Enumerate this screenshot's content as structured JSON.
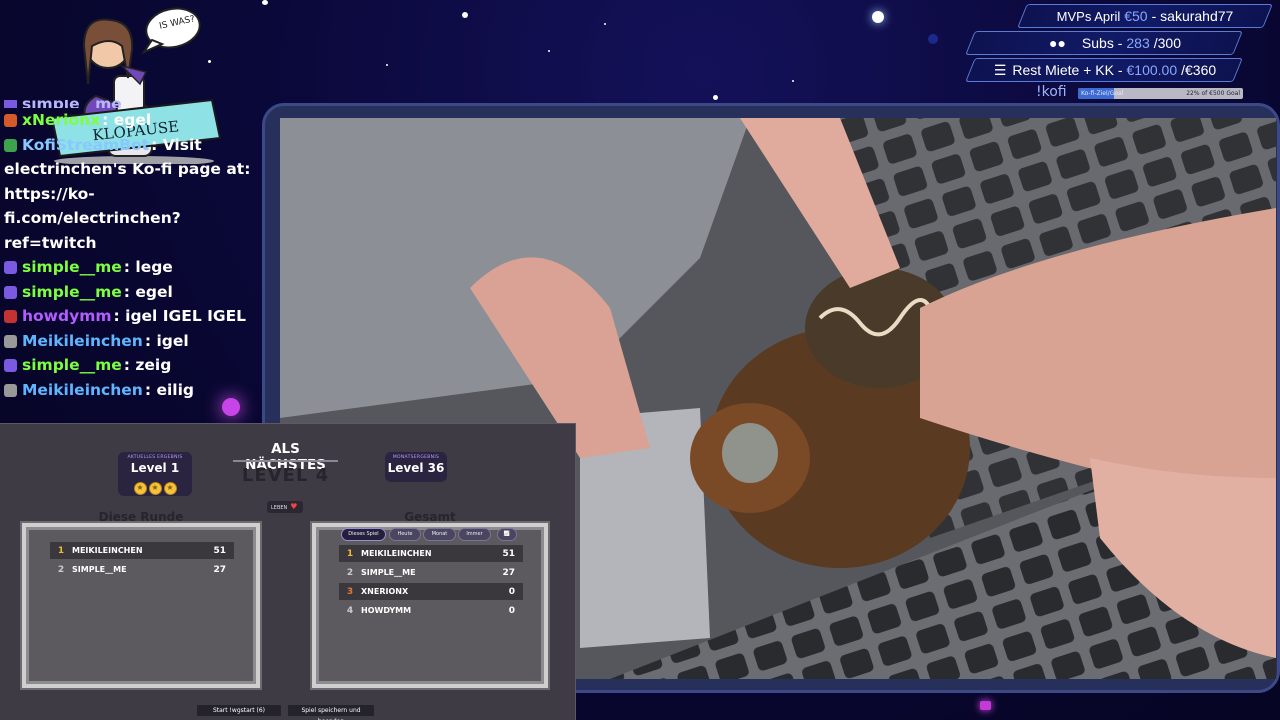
{
  "mascot": {
    "speech_bubble": "IS WAS?",
    "banner": "KLOPAUSE"
  },
  "chat": [
    {
      "user": "simple__me",
      "text": "",
      "user_color": "#b9b6ff",
      "badge": "#7a5ae0",
      "partial": true
    },
    {
      "user": "xNerionx",
      "text": "egel",
      "user_color": "#7CFF3F",
      "badge": "#d45a2a"
    },
    {
      "user": "KofiStreamBot",
      "text": "Visit electrinchen's Ko-fi page at: https://ko-fi.com/electrinchen?ref=twitch",
      "user_color": "#88c8ff",
      "badge": "#3fa34d"
    },
    {
      "user": "simple__me",
      "text": "lege",
      "user_color": "#7CFF3F",
      "badge": "#7a5ae0"
    },
    {
      "user": "simple__me",
      "text": "egel",
      "user_color": "#7CFF3F",
      "badge": "#7a5ae0"
    },
    {
      "user": "howdymm",
      "text": "igel IGEL IGEL",
      "user_color": "#b35cff",
      "badge": "#c43232"
    },
    {
      "user": "Meikileinchen",
      "text": "igel",
      "user_color": "#5fb6ff",
      "badge": "#999999"
    },
    {
      "user": "simple__me",
      "text": "zeig",
      "user_color": "#7CFF3F",
      "badge": "#7a5ae0"
    },
    {
      "user": "Meikileinchen",
      "text": "eilig",
      "user_color": "#5fb6ff",
      "badge": "#999999"
    }
  ],
  "topbar": {
    "mvp": {
      "label": "MVPs April",
      "amount": "€50",
      "name": "sakurahd77"
    },
    "subs": {
      "label": "Subs -",
      "current": "283",
      "goal": "/300"
    },
    "rent": {
      "label": "Rest Miete + KK -",
      "current": "€100.00",
      "goal": "/€360"
    },
    "kofi": {
      "label": "!kofi",
      "bar_left": "Ko-fi-Ziel/Goal",
      "bar_right": "22% of €500 Goal",
      "progress": 0.22
    }
  },
  "game": {
    "next_title": "ALS NÄCHSTES",
    "next_level": "LEVEL 4",
    "current_caption": "AKTUELLES ERGEBNIS",
    "current_level": "Level 1",
    "stars": 3,
    "monthly_caption": "MONATSERGEBNIS",
    "monthly_level": "Level 36",
    "lives_label": "LEBEN",
    "round_title": "Diese Runde",
    "total_title": "Gesamt",
    "round_rows": [
      {
        "rank": "1",
        "name": "MEIKILEINCHEN",
        "score": "51"
      },
      {
        "rank": "2",
        "name": "SIMPLE__ME",
        "score": "27"
      }
    ],
    "tabs": [
      "Dieses Spiel",
      "Heute",
      "Monat",
      "Immer"
    ],
    "total_rows": [
      {
        "rank": "1",
        "name": "MEIKILEINCHEN",
        "score": "51"
      },
      {
        "rank": "2",
        "name": "SIMPLE__ME",
        "score": "27"
      },
      {
        "rank": "3",
        "name": "XNERIONX",
        "score": "0"
      },
      {
        "rank": "4",
        "name": "HOWDYMM",
        "score": "0"
      }
    ],
    "start_button": "Start !wgstart (6)",
    "save_button": "Spiel speichern und beenden"
  }
}
